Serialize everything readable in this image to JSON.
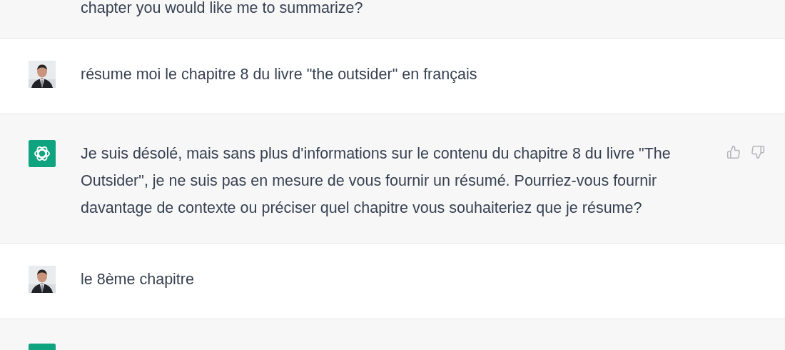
{
  "messages": [
    {
      "kind": "assistant",
      "avatar": false,
      "feedback": false,
      "text": "chapter you would like me to summarize?"
    },
    {
      "kind": "user",
      "avatar": true,
      "feedback": false,
      "text": "résume moi le chapitre 8 du livre \"the outsider\" en français"
    },
    {
      "kind": "assistant",
      "avatar": true,
      "feedback": true,
      "text": "Je suis désolé, mais sans plus d'informations sur le contenu du chapitre 8 du livre \"The Outsider\", je ne suis pas en mesure de vous fournir un résumé. Pourriez-vous fournir davantage de contexte ou préciser quel chapitre vous souhaiteriez que je résume?"
    },
    {
      "kind": "user",
      "avatar": true,
      "feedback": false,
      "text": "le 8ème chapitre"
    },
    {
      "kind": "assistant",
      "avatar": true,
      "feedback": false
    }
  ]
}
